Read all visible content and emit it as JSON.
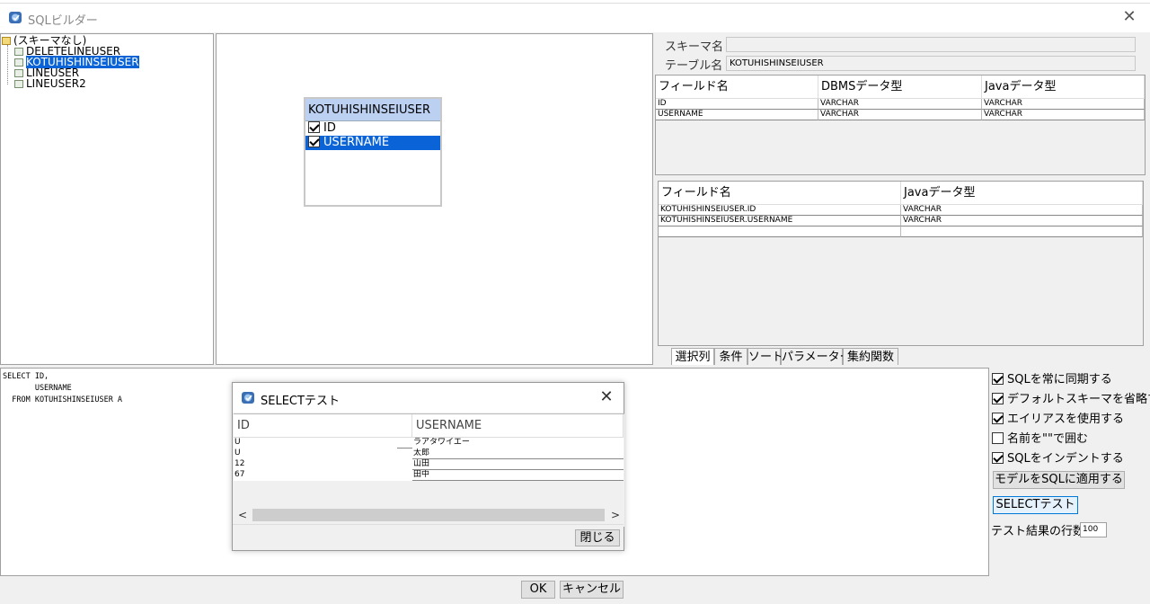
{
  "window": {
    "title": "SQLビルダー"
  },
  "tree": {
    "root": "(スキーマなし)",
    "items": [
      "DELETELINEUSER",
      "KOTUHISHINSEIUSER",
      "LINEUSER",
      "LINEUSER2"
    ],
    "selected_index": 1
  },
  "table_box": {
    "title": "KOTUHISHINSEIUSER",
    "fields": [
      {
        "name": "ID",
        "checked": true
      },
      {
        "name": "USERNAME",
        "checked": true
      }
    ]
  },
  "props": {
    "schema_label": "スキーマ名",
    "schema_value": "",
    "table_label": "テーブル名",
    "table_value": "KOTUHISHINSEIUSER"
  },
  "fields_grid": {
    "headers": [
      "フィールド名",
      "DBMSデータ型",
      "Javaデータ型"
    ],
    "rows": [
      [
        "ID",
        "VARCHAR",
        "VARCHAR"
      ],
      [
        "USERNAME",
        "VARCHAR",
        "VARCHAR"
      ]
    ]
  },
  "select_grid": {
    "headers": [
      "フィールド名",
      "Javaデータ型"
    ],
    "rows": [
      [
        "KOTUHISHINSEIUSER.ID",
        "VARCHAR"
      ],
      [
        "KOTUHISHINSEIUSER.USERNAME",
        "VARCHAR"
      ],
      [
        "",
        ""
      ]
    ]
  },
  "tabs": [
    "選択列",
    "条件",
    "ソート",
    "パラメーター",
    "集約関数"
  ],
  "sql": {
    "line1": "SELECT ID,",
    "line2": "       USERNAME",
    "line3": "  FROM KOTUHISHINSEIUSER A"
  },
  "options": {
    "sync": {
      "label": "SQLを常に同期する",
      "checked": true
    },
    "omit_schema": {
      "label": "デフォルトスキーマを省略する",
      "checked": true
    },
    "use_alias": {
      "label": "エイリアスを使用する",
      "checked": true
    },
    "quote_names": {
      "label": "名前を\"\"で囲む",
      "checked": false
    },
    "indent_sql": {
      "label": "SQLをインデントする",
      "checked": true
    }
  },
  "buttons": {
    "apply_model": "モデルをSQLに適用する",
    "select_test": "SELECTテスト",
    "ok": "OK",
    "cancel": "キャンセル"
  },
  "test_rows": {
    "label": "テスト結果の行数",
    "value": "100"
  },
  "dialog": {
    "title": "SELECTテスト",
    "headers": [
      "ID",
      "USERNAME"
    ],
    "rows": [
      [
        "U",
        "ラアタワイエー"
      ],
      [
        "U",
        "太郎"
      ],
      [
        "12",
        "山田"
      ],
      [
        "67",
        "田中"
      ]
    ],
    "close_button": "閉じる"
  }
}
